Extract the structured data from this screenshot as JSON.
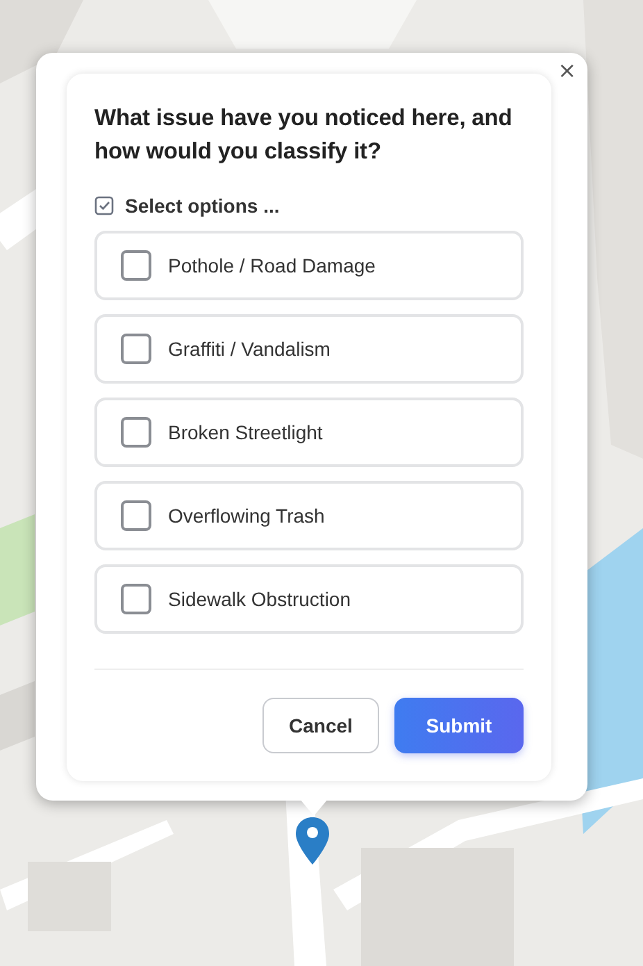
{
  "popup": {
    "close": "×",
    "question": "What issue have you noticed here, and how would you classify it?",
    "hint": "Select options ...",
    "options": [
      {
        "label": "Pothole / Road Damage",
        "checked": false
      },
      {
        "label": "Graffiti / Vandalism",
        "checked": false
      },
      {
        "label": "Broken Streetlight",
        "checked": false
      },
      {
        "label": "Overflowing Trash",
        "checked": false
      },
      {
        "label": "Sidewalk Obstruction",
        "checked": false
      }
    ],
    "buttons": [
      {
        "label": "Cancel",
        "kind": "secondary"
      },
      {
        "label": "Submit",
        "kind": "primary"
      }
    ]
  }
}
